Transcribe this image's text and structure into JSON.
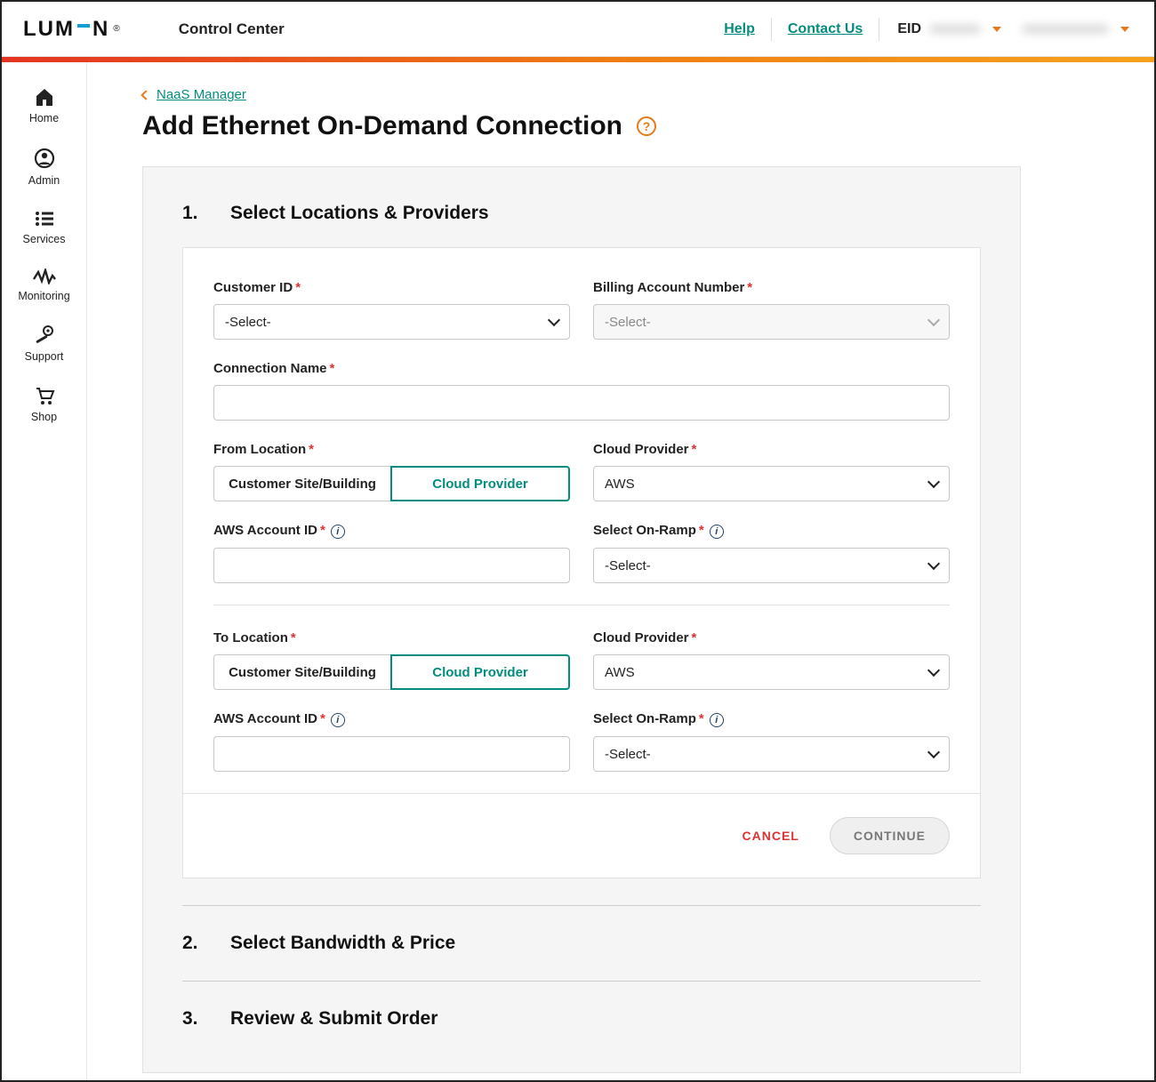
{
  "header": {
    "logo_text_left": "LUM",
    "logo_text_right": "N",
    "logo_trademark": "®",
    "app_title": "Control Center",
    "help": "Help",
    "contact": "Contact Us",
    "eid_label": "EID",
    "eid_value": "xxxxxxx",
    "account_value": "xxxxxxxxxxxx"
  },
  "sidebar": {
    "items": [
      {
        "label": "Home"
      },
      {
        "label": "Admin"
      },
      {
        "label": "Services"
      },
      {
        "label": "Monitoring"
      },
      {
        "label": "Support"
      },
      {
        "label": "Shop"
      }
    ]
  },
  "breadcrumb": {
    "label": "NaaS Manager"
  },
  "page": {
    "title": "Add Ethernet On-Demand Connection"
  },
  "steps": {
    "s1_num": "1.",
    "s1_title": "Select Locations & Providers",
    "s2_num": "2.",
    "s2_title": "Select Bandwidth & Price",
    "s3_num": "3.",
    "s3_title": "Review & Submit Order"
  },
  "form": {
    "customer_id": {
      "label": "Customer ID",
      "value": "-Select-"
    },
    "billing_account": {
      "label": "Billing Account Number",
      "value": "-Select-"
    },
    "connection_name": {
      "label": "Connection Name",
      "value": ""
    },
    "from_location": {
      "label": "From Location",
      "opt_site": "Customer Site/Building",
      "opt_cloud": "Cloud Provider"
    },
    "cloud_provider_from": {
      "label": "Cloud Provider",
      "value": "AWS"
    },
    "aws_account_from": {
      "label": "AWS Account ID",
      "value": ""
    },
    "on_ramp_from": {
      "label": "Select On-Ramp",
      "value": "-Select-"
    },
    "to_location": {
      "label": "To Location",
      "opt_site": "Customer Site/Building",
      "opt_cloud": "Cloud Provider"
    },
    "cloud_provider_to": {
      "label": "Cloud Provider",
      "value": "AWS"
    },
    "aws_account_to": {
      "label": "AWS Account ID",
      "value": ""
    },
    "on_ramp_to": {
      "label": "Select On-Ramp",
      "value": "-Select-"
    }
  },
  "actions": {
    "cancel": "CANCEL",
    "continue": "CONTINUE"
  }
}
